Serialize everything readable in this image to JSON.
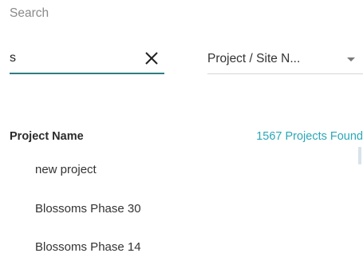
{
  "search": {
    "heading": "Search",
    "value": "s",
    "clear_icon": "close-icon"
  },
  "filter": {
    "selected": "Project / Site N...",
    "caret_icon": "caret-down-icon"
  },
  "results": {
    "column_header": "Project Name",
    "count_text": "1567 Projects Found",
    "items": [
      {
        "label": "new project"
      },
      {
        "label": "Blossoms Phase 30"
      },
      {
        "label": "Blossoms Phase 14"
      }
    ]
  },
  "colors": {
    "accent": "#2f7d84",
    "count": "#2aa7b8"
  }
}
